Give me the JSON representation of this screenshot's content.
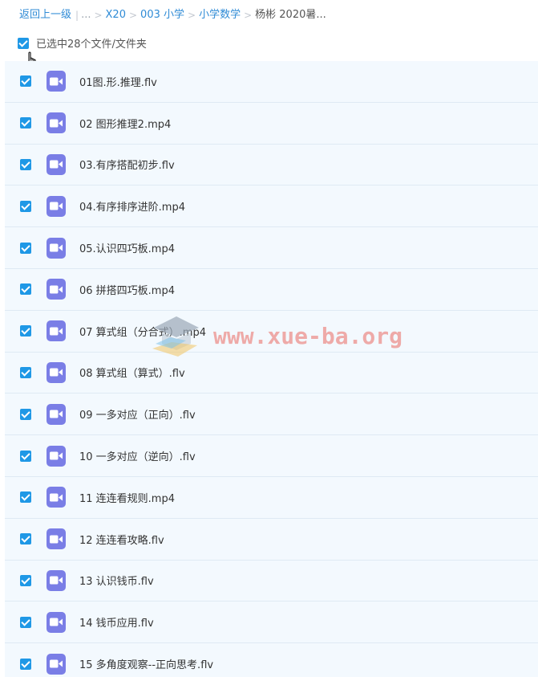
{
  "breadcrumb": {
    "back": "返回上一级",
    "divider": "|",
    "ellipsis": "...",
    "sep": ">",
    "items": [
      "X20",
      "003 小学",
      "小学数学"
    ],
    "current": "杨彬 2020暑..."
  },
  "selection": {
    "label": "已选中28个文件/文件夹",
    "checked": true
  },
  "files": [
    {
      "name": "01图.形.推理.flv",
      "checked": true
    },
    {
      "name": "02 图形推理2.mp4",
      "checked": true
    },
    {
      "name": "03.有序搭配初步.flv",
      "checked": true
    },
    {
      "name": "04.有序排序进阶.mp4",
      "checked": true
    },
    {
      "name": "05.认识四巧板.mp4",
      "checked": true
    },
    {
      "name": "06 拼搭四巧板.mp4",
      "checked": true
    },
    {
      "name": "07 算式组（分合式）.mp4",
      "checked": true
    },
    {
      "name": "08 算式组（算式）.flv",
      "checked": true
    },
    {
      "name": "09 一多对应（正向）.flv",
      "checked": true
    },
    {
      "name": "10 一多对应（逆向）.flv",
      "checked": true
    },
    {
      "name": "11 连连看规则.mp4",
      "checked": true
    },
    {
      "name": "12 连连看攻略.flv",
      "checked": true
    },
    {
      "name": "13 认识钱币.flv",
      "checked": true
    },
    {
      "name": "14 钱币应用.flv",
      "checked": true
    },
    {
      "name": "15 多角度观察--正向思考.flv",
      "checked": true
    }
  ],
  "file_icon": "video-file-icon",
  "watermark": {
    "text": "www.xue-ba.org",
    "icon": "graduation-cap-icon"
  },
  "colors": {
    "accent": "#1f98e6",
    "link": "#2f8bd6",
    "video_icon": "#7a7ee6",
    "row_bg": "#f3f9fe"
  }
}
